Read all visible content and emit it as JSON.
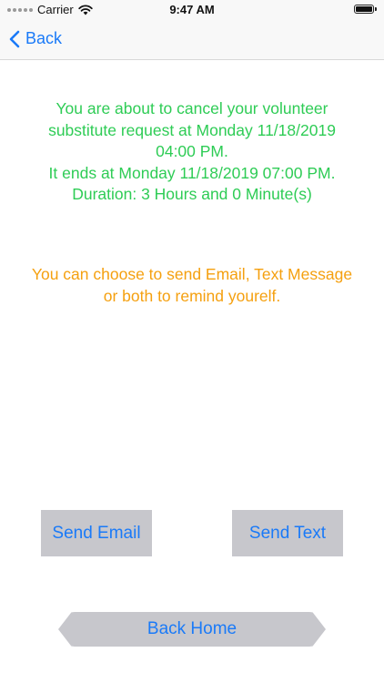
{
  "status_bar": {
    "carrier": "Carrier",
    "time": "9:47 AM",
    "battery_level": 1.0
  },
  "nav": {
    "back_label": "Back",
    "accent_color": "#1a7af8"
  },
  "message": {
    "line1": "You are about to cancel your volunteer",
    "line2": "substitute request at Monday 11/18/2019",
    "line3": "04:00 PM.",
    "line4": "It ends at Monday 11/18/2019 07:00 PM.",
    "line5": "Duration: 3 Hours and 0 Minute(s)",
    "color": "#2ecc55"
  },
  "reminder": {
    "line1": "You can choose to send Email, Text Message",
    "line2": "or both to remind yourelf.",
    "color": "#f5a00f"
  },
  "buttons": {
    "send_email": "Send Email",
    "send_text": "Send Text",
    "back_home": "Back Home",
    "background": "#c7c7cc"
  }
}
